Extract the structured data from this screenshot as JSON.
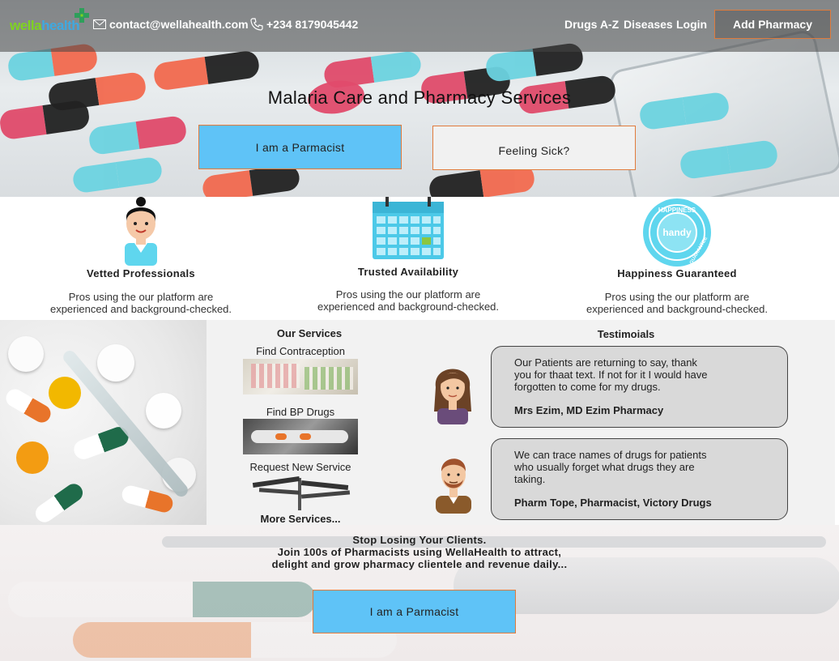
{
  "header": {
    "logo_text_a": "wella",
    "logo_text_b": "health",
    "email": "contact@wellahealth.com",
    "phone": "+234 8179045442",
    "nav": [
      "Drugs A-Z",
      "Diseases",
      "Login"
    ],
    "add_pharmacy": "Add Pharmacy"
  },
  "hero": {
    "title": "Malaria Care and Pharmacy Services",
    "pharmacist_button": "I am a Parmacist",
    "sick_button": "Feeling Sick?"
  },
  "features": [
    {
      "title": "Vetted Professionals",
      "desc1": "Pros using the our platform are",
      "desc2": "experienced and background-checked."
    },
    {
      "title": "Trusted Availability",
      "desc1": "Pros using the our platform are",
      "desc2": "experienced and background-checked."
    },
    {
      "title": "Happiness Guaranteed",
      "desc1": "Pros using the our platform are",
      "desc2": "experienced and background-checked."
    }
  ],
  "badge": {
    "top": "HAPPINESS",
    "middle": "handy",
    "right": "GUARANTEE"
  },
  "services": {
    "title": "Our Services",
    "items": [
      "Find Contraception",
      "Find BP Drugs",
      "Request New Service"
    ],
    "more": "More Services..."
  },
  "testimonials": {
    "title": "Testimoials",
    "items": [
      {
        "l1": "Our Patients are returning to say, thank",
        "l2": "you for thaat text. If not for it I would have",
        "l3": "forgotten to come for my drugs.",
        "who": "Mrs Ezim, MD Ezim Pharmacy"
      },
      {
        "l1": "We can trace names of drugs for patients",
        "l2": "who usually forget what drugs they are",
        "l3": "taking.",
        "who": "Pharm Tope, Pharmacist, Victory Drugs"
      }
    ]
  },
  "cta": {
    "line1": "Stop Losing Your Clients.",
    "line2": "Join 100s of Pharmacists using WellaHealth to attract,",
    "line3": "delight and grow pharmacy clientele and revenue daily...",
    "button": "I am a Parmacist"
  },
  "colors": {
    "accent_blue": "#5fc3f7",
    "border_orange": "#e07b3c",
    "logo_green": "#7ed321",
    "logo_blue": "#3fa9e0"
  },
  "icons": [
    "mail-icon",
    "phone-icon",
    "nurse-icon",
    "calendar-icon",
    "happiness-badge-icon",
    "woman-avatar-icon",
    "man-avatar-icon"
  ]
}
